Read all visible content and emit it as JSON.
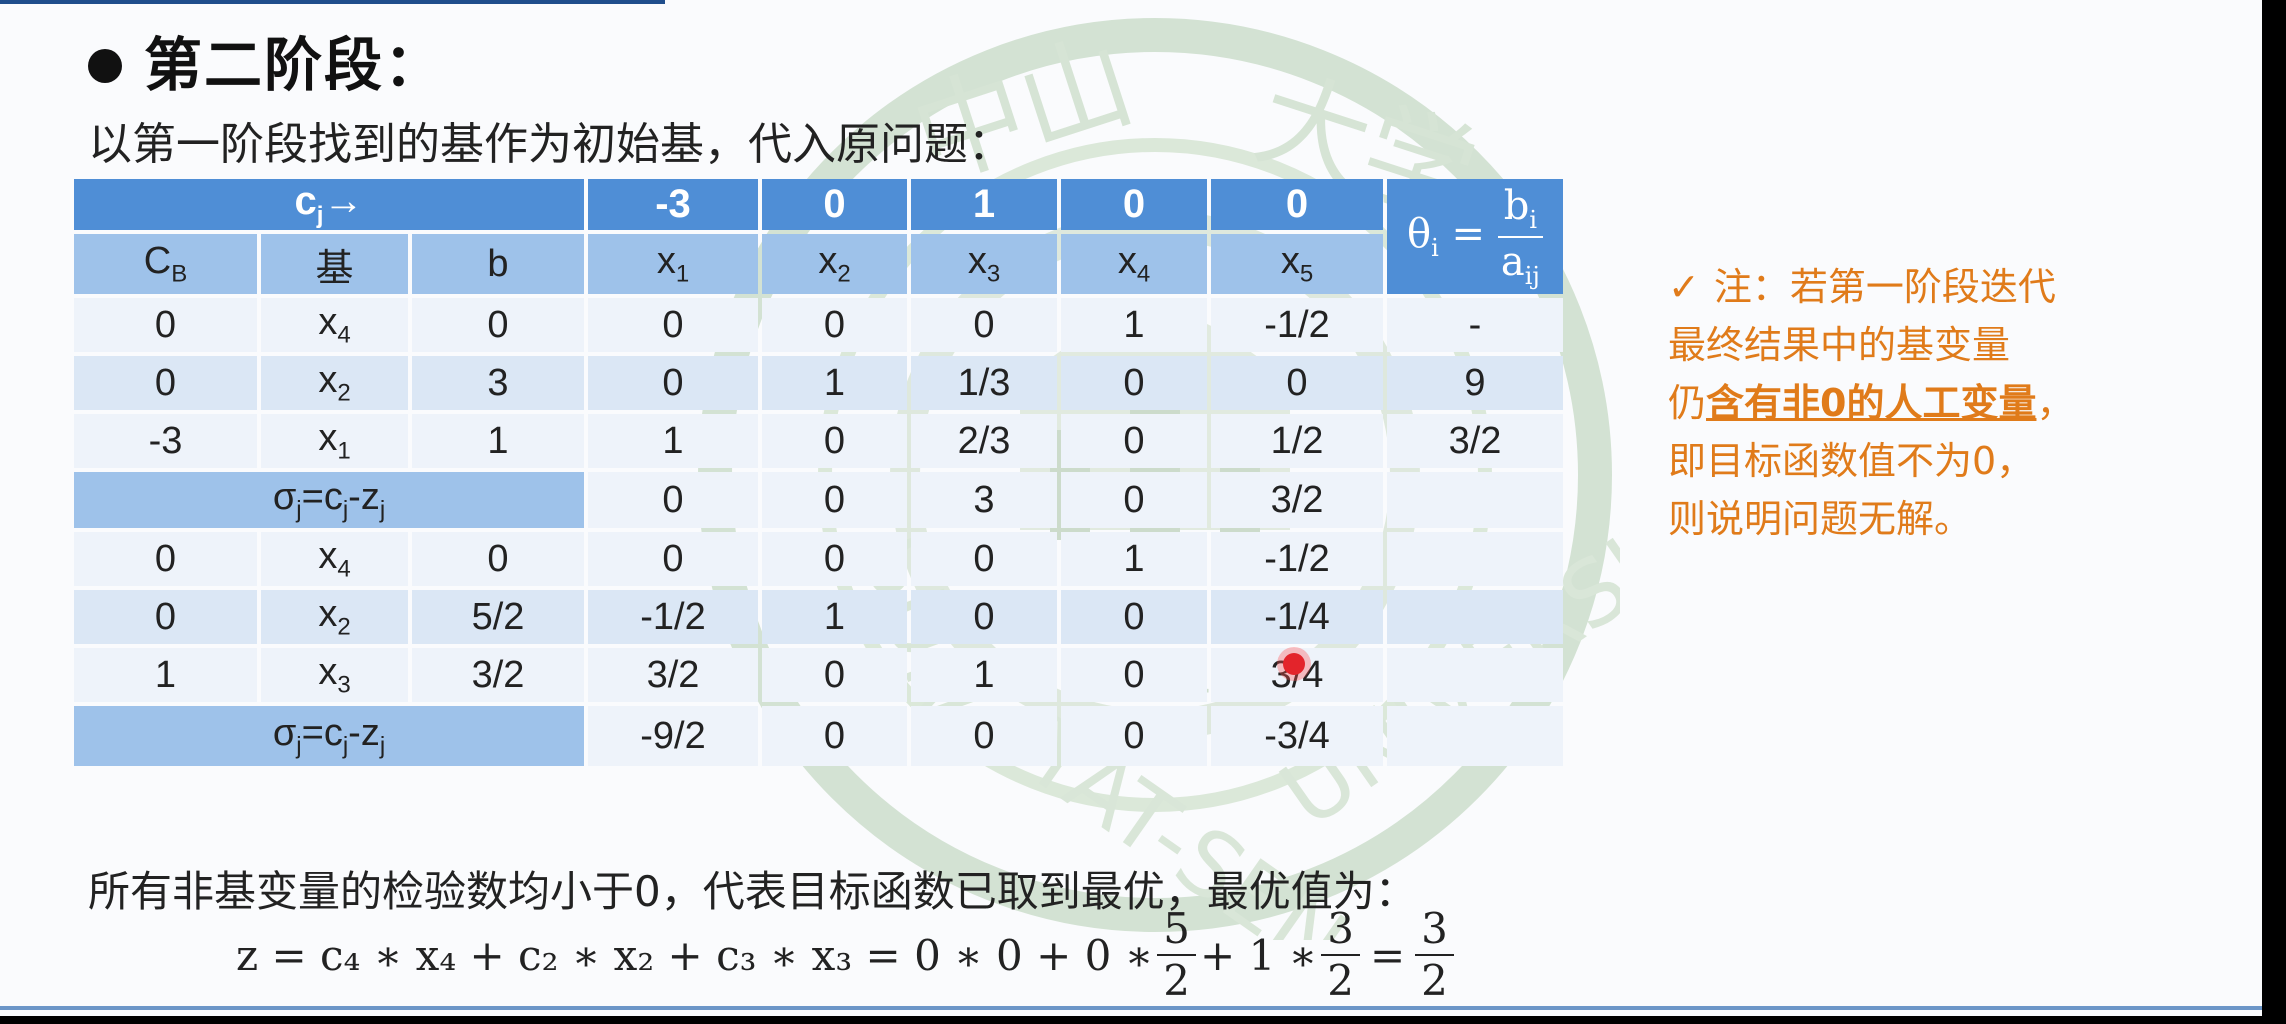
{
  "slide": {
    "heading": "第二阶段：",
    "intro": "以第一阶段找到的基作为初始基，代入原问题：",
    "note_lines": [
      "注：若第一阶段迭代",
      "最终结果中的基变量",
      "仍",
      "含有非0的人工变量",
      "，",
      "即目标函数值不为0，",
      "则说明问题无解。"
    ],
    "conclusion": "所有非基变量的检验数均小于0，代表目标函数已取到最优，最优值为：",
    "formula": {
      "lhs": "z = c",
      "full": "z = c₄ ∗ x₄ + c₂ ∗ x₂ + c₃ ∗ x₃ = 0 ∗ 0 + 0 ∗",
      "frac1_num": "5",
      "frac1_den": "2",
      "mid": "+ 1 ∗",
      "frac2_num": "3",
      "frac2_den": "2",
      "eq": "=",
      "frac3_num": "3",
      "frac3_den": "2"
    },
    "watermark": {
      "text_top": "中山大学",
      "text_ring": "SUN YAT-SEN UNIVERSITY",
      "year": "1924"
    }
  },
  "table": {
    "cj_label": "c",
    "cj_sub": "j",
    "cj_arrow": "→",
    "cj_values": [
      "-3",
      "0",
      "1",
      "0",
      "0"
    ],
    "theta": {
      "lhs": "θ",
      "lhs_sub": "i",
      "eq": "=",
      "num": "b",
      "num_sub": "i",
      "den": "a",
      "den_sub": "ij"
    },
    "headers": {
      "cb": "C",
      "cb_sub": "B",
      "basis": "基",
      "b": "b",
      "vars": [
        {
          "v": "x",
          "s": "1"
        },
        {
          "v": "x",
          "s": "2"
        },
        {
          "v": "x",
          "s": "3"
        },
        {
          "v": "x",
          "s": "4"
        },
        {
          "v": "x",
          "s": "5"
        }
      ]
    },
    "sigma_label": {
      "sigma": "σ",
      "sub": "j",
      "rest": "=c",
      "rest_sub": "j",
      "minus": "-z",
      "minus_sub": "j"
    },
    "block1": [
      {
        "cb": "0",
        "bv": "x",
        "bs": "4",
        "b": "0",
        "vals": [
          "0",
          "0",
          "0",
          "1",
          "-1/2"
        ],
        "theta": "-"
      },
      {
        "cb": "0",
        "bv": "x",
        "bs": "2",
        "b": "3",
        "vals": [
          "0",
          "1",
          "1/3",
          "0",
          "0"
        ],
        "theta": "9"
      },
      {
        "cb": "-3",
        "bv": "x",
        "bs": "1",
        "b": "1",
        "vals": [
          "1",
          "0",
          "2/3",
          "0",
          "1/2"
        ],
        "theta": "3/2"
      }
    ],
    "sigma1": [
      "0",
      "0",
      "3",
      "0",
      "3/2"
    ],
    "block2": [
      {
        "cb": "0",
        "bv": "x",
        "bs": "4",
        "b": "0",
        "vals": [
          "0",
          "0",
          "0",
          "1",
          "-1/2"
        ],
        "theta": ""
      },
      {
        "cb": "0",
        "bv": "x",
        "bs": "2",
        "b": "5/2",
        "vals": [
          "-1/2",
          "1",
          "0",
          "0",
          "-1/4"
        ],
        "theta": ""
      },
      {
        "cb": "1",
        "bv": "x",
        "bs": "3",
        "b": "3/2",
        "vals": [
          "3/2",
          "0",
          "1",
          "0",
          "3/4"
        ],
        "theta": ""
      }
    ],
    "sigma2": [
      "-9/2",
      "0",
      "0",
      "0",
      "-3/4"
    ]
  },
  "colors": {
    "header_dark": "#4f8ed6",
    "header_light": "#9ec2ea",
    "row_alt": "#dbe7f5",
    "row_plain": "#eef3fa",
    "note": "#e07b1a"
  }
}
